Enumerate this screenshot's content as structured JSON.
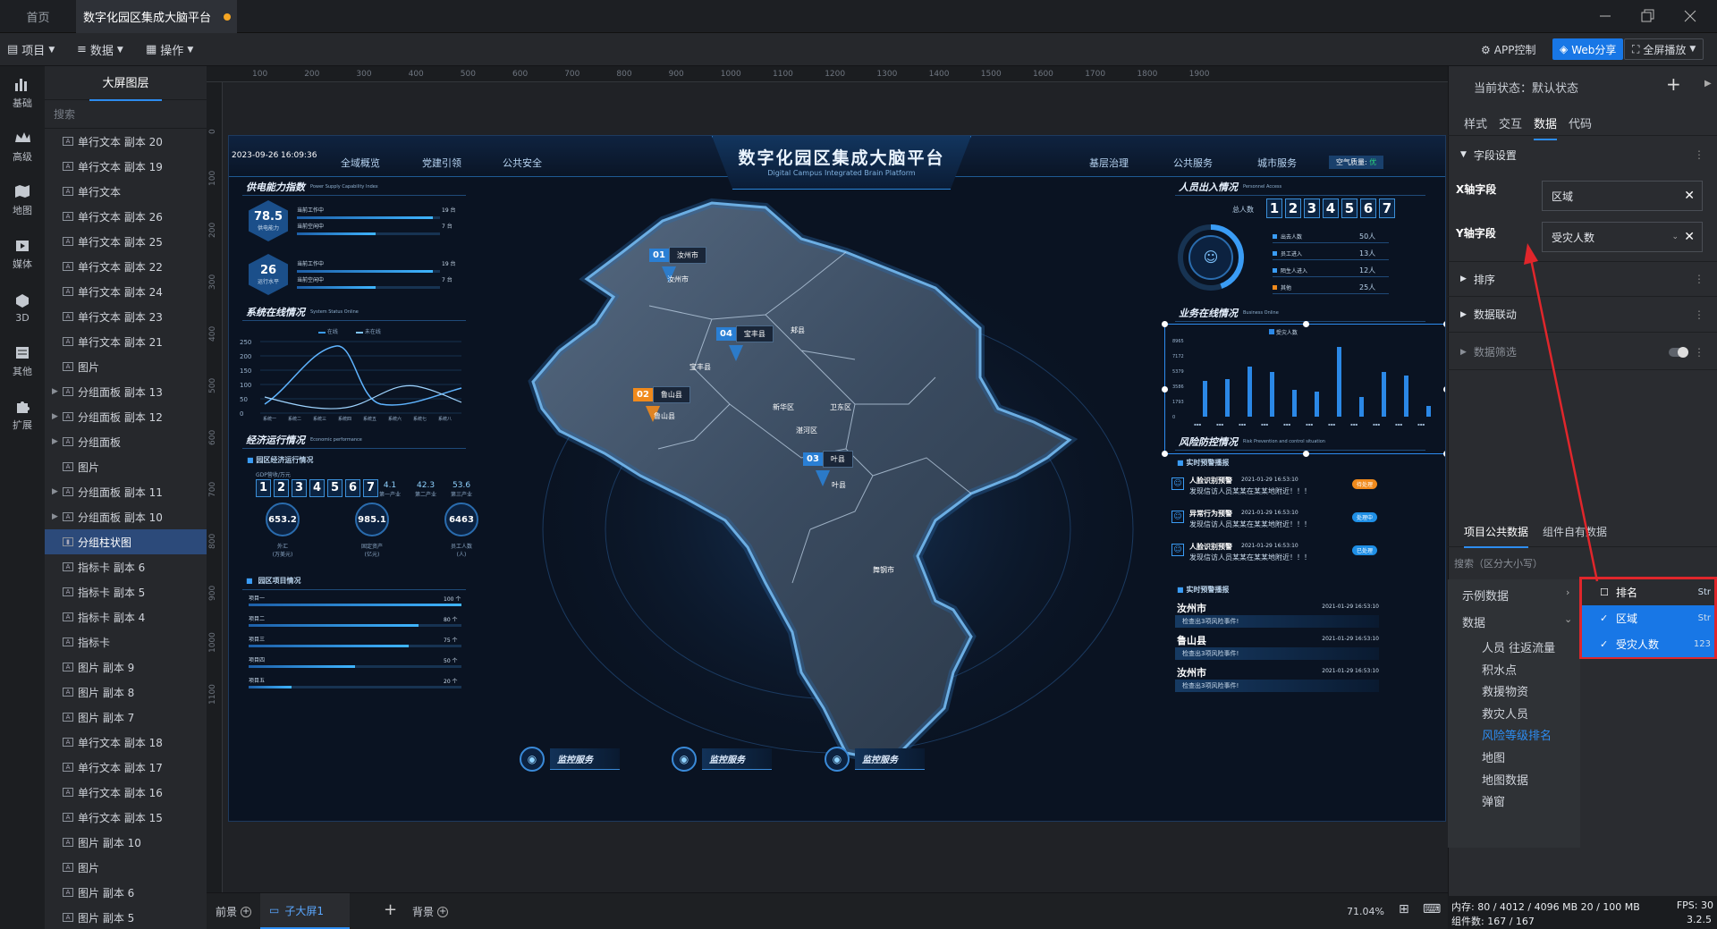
{
  "tabs": {
    "home": "首页",
    "active": "数字化园区集成大脑平台"
  },
  "toolbar": {
    "project": "项目",
    "data": "数据",
    "ops": "操作",
    "app_control": "APP控制",
    "web_share": "Web分享",
    "fullscreen": "全屏播放"
  },
  "leftnav": [
    {
      "label": "基础",
      "icon": "bar-chart-icon"
    },
    {
      "label": "高级",
      "icon": "crown-icon"
    },
    {
      "label": "地图",
      "icon": "map-icon"
    },
    {
      "label": "媒体",
      "icon": "media-icon"
    },
    {
      "label": "3D",
      "icon": "cube-icon"
    },
    {
      "label": "其他",
      "icon": "list-icon"
    },
    {
      "label": "扩展",
      "icon": "puzzle-icon"
    }
  ],
  "layers": {
    "title": "大屏图层",
    "search_placeholder": "搜索",
    "items": [
      {
        "label": "单行文本 副本 20",
        "group": false
      },
      {
        "label": "单行文本 副本 19",
        "group": false
      },
      {
        "label": "单行文本",
        "group": false
      },
      {
        "label": "单行文本 副本 26",
        "group": false
      },
      {
        "label": "单行文本 副本 25",
        "group": false
      },
      {
        "label": "单行文本 副本 22",
        "group": false
      },
      {
        "label": "单行文本 副本 24",
        "group": false
      },
      {
        "label": "单行文本 副本 23",
        "group": false
      },
      {
        "label": "单行文本 副本 21",
        "group": false
      },
      {
        "label": "图片",
        "group": false
      },
      {
        "label": "分组面板 副本 13",
        "group": true
      },
      {
        "label": "分组面板 副本 12",
        "group": true
      },
      {
        "label": "分组面板",
        "group": true
      },
      {
        "label": "图片",
        "group": false
      },
      {
        "label": "分组面板 副本 11",
        "group": true
      },
      {
        "label": "分组面板 副本 10",
        "group": true
      },
      {
        "label": "分组柱状图",
        "group": false,
        "selected": true
      },
      {
        "label": "指标卡 副本 6",
        "group": false
      },
      {
        "label": "指标卡 副本 5",
        "group": false
      },
      {
        "label": "指标卡 副本 4",
        "group": false
      },
      {
        "label": "指标卡",
        "group": false
      },
      {
        "label": "图片 副本 9",
        "group": false
      },
      {
        "label": "图片 副本 8",
        "group": false
      },
      {
        "label": "图片 副本 7",
        "group": false
      },
      {
        "label": "单行文本 副本 18",
        "group": false
      },
      {
        "label": "单行文本 副本 17",
        "group": false
      },
      {
        "label": "单行文本 副本 16",
        "group": false
      },
      {
        "label": "单行文本 副本 15",
        "group": false
      },
      {
        "label": "图片 副本 10",
        "group": false
      },
      {
        "label": "图片",
        "group": false
      },
      {
        "label": "图片 副本 6",
        "group": false
      },
      {
        "label": "图片 副本 5",
        "group": false
      }
    ]
  },
  "ruler": {
    "h": [
      "100",
      "200",
      "300",
      "400",
      "500",
      "600",
      "700",
      "800",
      "900",
      "1000",
      "1100",
      "1200",
      "1300",
      "1400",
      "1500",
      "1600",
      "1700",
      "1800",
      "1900"
    ],
    "v": [
      "0",
      "100",
      "200",
      "300",
      "400",
      "500",
      "600",
      "700",
      "800",
      "900",
      "1000",
      "1100"
    ]
  },
  "screen": {
    "date": "2023-09-26",
    "time": "16:09:36",
    "nav_left": [
      "全域概览",
      "党建引领",
      "公共安全"
    ],
    "nav_right": [
      "基层治理",
      "公共服务",
      "城市服务"
    ],
    "air_label": "空气质量:",
    "air_value": "优",
    "title": "数字化园区集成大脑平台",
    "subtitle": "Digital Campus Integrated Brain Platform",
    "power": {
      "title": "供电能力指数",
      "en": "Power Supply Capability Index",
      "items": [
        {
          "value": "78.5",
          "label": "供电能力",
          "rows": [
            {
              "name": "当前工作中",
              "val": "19 台",
              "pct": 0.95
            },
            {
              "name": "当前空闲中",
              "val": "7 台",
              "pct": 0.55
            }
          ]
        },
        {
          "value": "26",
          "label": "运行水平",
          "rows": [
            {
              "name": "当前工作中",
              "val": "19 台",
              "pct": 0.95
            },
            {
              "name": "当前空闲中",
              "val": "7 台",
              "pct": 0.55
            }
          ]
        }
      ]
    },
    "system": {
      "title": "系统在线情况",
      "en": "System Status Online",
      "legend": [
        "在线",
        "未在线"
      ],
      "yticks": [
        "250",
        "200",
        "150",
        "100",
        "50",
        "0"
      ],
      "xticks": [
        "系统一",
        "系统二",
        "系统三",
        "系统四",
        "系统五",
        "系统六",
        "系统七",
        "系统八"
      ]
    },
    "economy": {
      "title": "经济运行情况",
      "en": "Economic performance",
      "sub": "园区经济运行情况",
      "gdp_label": "GDP营收/万元",
      "gdp_digits": [
        "1",
        "2",
        "3",
        "4",
        "5",
        "6",
        "7"
      ],
      "ratios": [
        "4.1",
        "42.3",
        "53.6"
      ],
      "ratio_labels": [
        "第一产业",
        "第二产业",
        "第三产业"
      ],
      "circles": [
        {
          "value": "653.2",
          "l1": "外汇",
          "l2": "(万美元)"
        },
        {
          "value": "985.1",
          "l1": "固定资产",
          "l2": "(亿元)"
        },
        {
          "value": "6463",
          "l1": "员工人数",
          "l2": "(人)"
        }
      ]
    },
    "projects": {
      "title": "园区项目情况",
      "items": [
        {
          "name": "项目一",
          "val": "100 个",
          "pct": 1.0
        },
        {
          "name": "项目二",
          "val": "80 个",
          "pct": 0.8
        },
        {
          "name": "项目三",
          "val": "75 个",
          "pct": 0.75
        },
        {
          "name": "项目四",
          "val": "50 个",
          "pct": 0.5
        },
        {
          "name": "项目五",
          "val": "20 个",
          "pct": 0.2
        }
      ]
    },
    "map": {
      "pins": [
        {
          "num": "01",
          "name": "汝州市",
          "color": "#2a7fd4"
        },
        {
          "num": "04",
          "name": "宝丰县",
          "color": "#2a7fd4"
        },
        {
          "num": "02",
          "name": "鲁山县",
          "color": "#f08a1c"
        },
        {
          "num": "03",
          "name": "叶县",
          "color": "#2a7fd4"
        }
      ],
      "labels": [
        "汝州市",
        "郏县",
        "宝丰县",
        "鲁山县",
        "新华区",
        "卫东区",
        "湛河区",
        "叶县",
        "舞钢市"
      ]
    },
    "personnel": {
      "title": "人员出入情况",
      "en": "Personnel Access",
      "total_label": "总人数",
      "digits": [
        "1",
        "2",
        "3",
        "4",
        "5",
        "6",
        "7"
      ],
      "rows": [
        {
          "name": "出去人数",
          "val": "50人",
          "color": "#3a9cf5"
        },
        {
          "name": "员工进入",
          "val": "13人",
          "color": "#3a9cf5"
        },
        {
          "name": "陌生人进入",
          "val": "12人",
          "color": "#3a9cf5"
        },
        {
          "name": "其他",
          "val": "25人",
          "color": "#f08a1c"
        }
      ]
    },
    "business": {
      "title": "业务在线情况",
      "en": "Business Online",
      "legend": "受灾人数",
      "yticks": [
        "8965",
        "7172",
        "5379",
        "3586",
        "1793",
        "0"
      ]
    },
    "risk": {
      "title": "风险防控情况",
      "en": "Risk Prevention and control situation",
      "sub": "实时预警播报",
      "alerts": [
        {
          "type": "人脸识别预警",
          "time": "2021-01-29 16:53:10",
          "msg": "发现信访人员某某在某某地附近！！！",
          "badge": "待处理",
          "badge_color": "#f08a1c"
        },
        {
          "type": "异常行为预警",
          "time": "2021-01-29 16:53:10",
          "msg": "发现信访人员某某在某某地附近！！！",
          "badge": "处理中",
          "badge_color": "#1f8fe6"
        },
        {
          "type": "人脸识别预警",
          "time": "2021-01-29 16:53:10",
          "msg": "发现信访人员某某在某某地附近！！！",
          "badge": "已处理",
          "badge_color": "#1f8fe6"
        }
      ],
      "sub2": "实时预警播报",
      "broadcasts": [
        {
          "place": "汝州市",
          "time": "2021-01-29 16:53:10",
          "msg": "检查出3项风险事件!"
        },
        {
          "place": "鲁山县",
          "time": "2021-01-29 16:53:10",
          "msg": "检查出3项风险事件!"
        },
        {
          "place": "汝州市",
          "time": "2021-01-29 16:53:10",
          "msg": "检查出3项风险事件!"
        }
      ]
    },
    "monitor_buttons": [
      "监控服务",
      "监控服务",
      "监控服务"
    ]
  },
  "bottom": {
    "front": "前景",
    "child": "子大屏1",
    "back": "背景",
    "zoom": "71.04%"
  },
  "right": {
    "state_label": "当前状态：",
    "state_value": "默认状态",
    "tabs": [
      "样式",
      "交互",
      "数据",
      "代码"
    ],
    "field_section": "字段设置",
    "x_label": "X轴字段",
    "x_value": "区域",
    "y_label": "Y轴字段",
    "y_value": "受灾人数",
    "sort": "排序",
    "linkage": "数据联动",
    "filter": "数据筛选",
    "data_tabs": [
      "项目公共数据",
      "组件自有数据"
    ],
    "search_placeholder": "搜索（区分大小写）",
    "example": "示例数据",
    "data": "数据",
    "datasets": [
      "人员 往返流量",
      "积水点",
      "救援物资",
      "救灾人员",
      "风险等级排名",
      "地图",
      "地图数据",
      "弹窗"
    ],
    "active_dataset": "风险等级排名",
    "popup": [
      {
        "label": "排名",
        "type": "Str",
        "checked": false
      },
      {
        "label": "区域",
        "type": "Str",
        "checked": true
      },
      {
        "label": "受灾人数",
        "type": "123",
        "checked": true
      }
    ],
    "accent": "#e0262b"
  },
  "status": {
    "mem": "内存: 80 / 4012 / 4096 MB  20 / 100 MB",
    "fps": "FPS: 30",
    "components": "组件数: 167 / 167",
    "version": "3.2.5"
  }
}
